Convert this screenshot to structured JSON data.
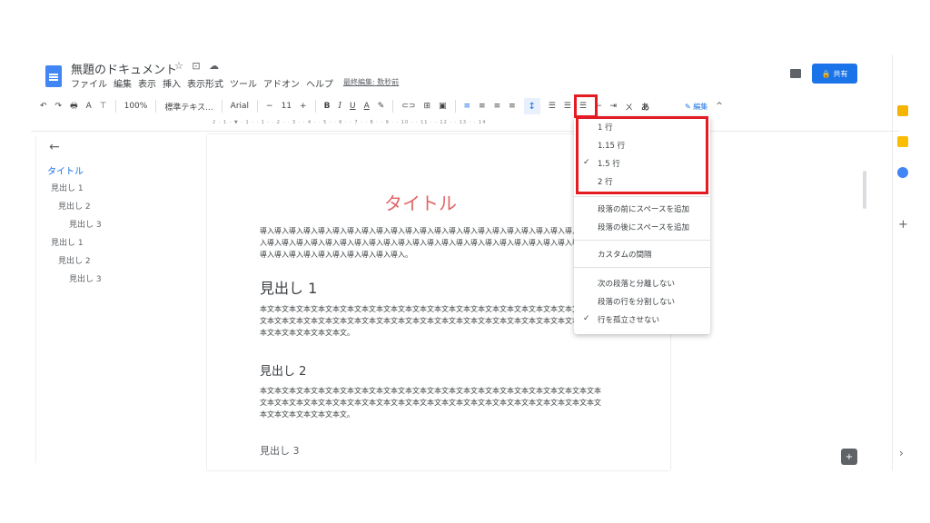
{
  "header": {
    "doc_title": "無題のドキュメント",
    "title_icons": "☆ ⊡ ☁",
    "menus": [
      "ファイル",
      "編集",
      "表示",
      "挿入",
      "表示形式",
      "ツール",
      "アドオン",
      "ヘルプ"
    ],
    "last_edit": "最終編集: 数秒前",
    "share_label": "共有"
  },
  "toolbar": {
    "undo": "↶",
    "redo": "↷",
    "print": "🖶",
    "spell": "A",
    "paint": "⊤",
    "zoom": "100%",
    "style": "標準テキス...",
    "font": "Arial",
    "minus": "−",
    "font_size": "11",
    "plus": "+",
    "bold": "B",
    "italic": "I",
    "underline": "U",
    "text_color": "A",
    "highlight": "✎",
    "link": "⊂⊃",
    "comment": "⊞",
    "image": "▣",
    "align_left": "≡",
    "align_center": "≡",
    "align_right": "≡",
    "align_justify": "≡",
    "line_spacing": "↕",
    "checklist": "☰",
    "bullets": "☰",
    "numbered": "☰",
    "indent_less": "⇤",
    "indent_more": "⇥",
    "clear": "ㄨ",
    "input_tools": "あ",
    "editing_mode": "✎ 編集",
    "collapse": "^"
  },
  "ruler": {
    "text": "2 · 1 · ▼ · 1 · · 1 · · 2 · · 3 · · 4 · · 5 · · 6 · · 7 · · 8 · · 9 · · 10 · · 11 · · 12 · · 13 · · 14"
  },
  "outline": {
    "back": "←",
    "items": [
      {
        "label": "タイトル"
      },
      {
        "label": "見出し 1"
      },
      {
        "label": "見出し 2"
      },
      {
        "label": "見出し 3"
      },
      {
        "label": "見出し 1"
      },
      {
        "label": "見出し 2"
      },
      {
        "label": "見出し 3"
      }
    ]
  },
  "document": {
    "title": "タイトル",
    "intro": "導入導入導入導入導入導入導入導入導入導入導入導入導入導入導入導入導入導入導入導入導入導入導入導入導入導入導入導入導入導入導入導入導入導入導入導入導入導入導入導入導入導入導入導入導入導入導入導入導入導入導入導入導入導入導入導入導入。",
    "h1": "見出し 1",
    "body1": "本文本文本文本文本文本文本文本文本文本文本文本文本文本文本文本文本文本文本文本文本文本文本文本文本文本文本文本文本文本文本文本文本文本文本文本文本文本文本文本文本文本文本文本文本文本文本文本文本文本文本文本文本文。",
    "h2": "見出し 2",
    "body2": "本文本文本文本文本文本文本文本文本文本文本文本文本文本文本文本文本文本文本文本文本文本文本文本文本文本文本文本文本文本文本文本文本文本文本文本文本文本文本文本文本文本文本文本文本文本文本文本文本文本文本文本文本文。",
    "h3": "見出し 3"
  },
  "line_spacing_menu": {
    "options": [
      "1 行",
      "1.15 行",
      "1.5 行",
      "2 行"
    ],
    "selected_index": 2,
    "check": "✓",
    "add_before": "段落の前にスペースを追加",
    "add_after": "段落の後にスペースを追加",
    "custom": "カスタムの間隔",
    "keep_with_next": "次の段落と分離しない",
    "keep_lines": "段落の行を分割しない",
    "prevent_widow": "行を孤立させない",
    "prevent_widow_checked": true
  },
  "sidebar": {
    "plus": "+",
    "chevron": "›",
    "explore": "+"
  },
  "colors": {
    "highlight_red": "#e41b23",
    "share_blue": "#1a73e8",
    "title_red": "#e06666"
  }
}
